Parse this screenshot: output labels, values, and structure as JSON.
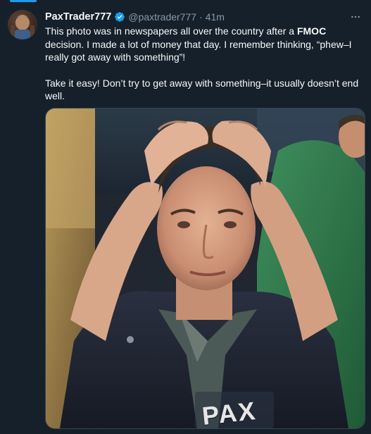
{
  "tweet": {
    "display_name": "PaxTrader777",
    "handle": "@paxtrader777",
    "separator": "·",
    "time": "41m",
    "more_icon": "more-horizontal-icon",
    "verified_icon": "verified-badge-icon",
    "body": {
      "line1_pre": "This photo was in newspapers all over the country after a ",
      "line1_bold": "FMOC",
      "line1_post": " decision. I made a lot of money that day. I remember thinking, “phew–I really got away with something”!",
      "line2": "Take it easy! Don’t try to get away with something–it usually doesn’t end well."
    },
    "media": {
      "badge_text": "PAX"
    }
  },
  "colors": {
    "background": "#15202b",
    "text_primary": "#f7f9f9",
    "text_secondary": "#8b98a5",
    "accent": "#1d9bf0",
    "border": "#38444d"
  }
}
